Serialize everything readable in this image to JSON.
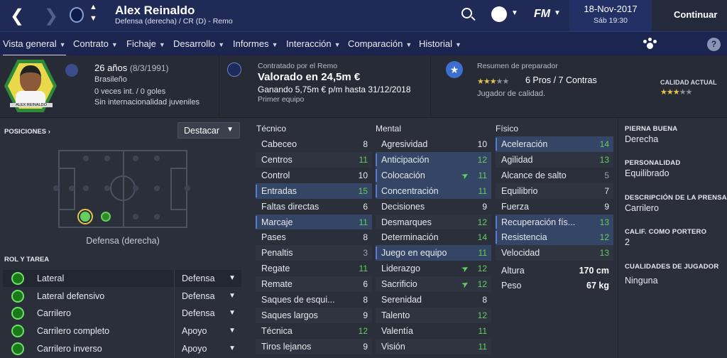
{
  "topbar": {
    "player_name": "Alex Reinaldo",
    "player_subtitle": "Defensa (derecha) / CR (D) - Remo",
    "date": "18-Nov-2017",
    "day_time": "Sáb 19:30",
    "continue_label": "Continuar",
    "fm_logo": "FM"
  },
  "nav": {
    "items": [
      {
        "label": "Vista general"
      },
      {
        "label": "Contrato"
      },
      {
        "label": "Fichaje"
      },
      {
        "label": "Desarrollo"
      },
      {
        "label": "Informes"
      },
      {
        "label": "Interacción"
      },
      {
        "label": "Comparación"
      },
      {
        "label": "Historial"
      }
    ]
  },
  "profile": {
    "photo_caption": "ALEX REINALDO",
    "age": "26 años",
    "birth": "(8/3/1991)",
    "nationality": "Brasileño",
    "caps": "0 veces int. / 0 goles",
    "youth": "Sin internacionalidad juveniles"
  },
  "contract": {
    "title": "Contratado por el Remo",
    "value": "Valorado en 24,5m €",
    "wage": "Ganando 5,75m € p/m hasta 31/12/2018",
    "squad": "Primer equipo"
  },
  "coach": {
    "title": "Resumen de preparador",
    "pros_cons": "6 Pros / 7 Contras",
    "verdict": "Jugador de calidad.",
    "stars": 2.5,
    "current_label": "CALIDAD ACTUAL",
    "current_stars": 2.5
  },
  "positions": {
    "title": "POSICIONES",
    "dropdown": "Destacar",
    "label": "Defensa (derecha)"
  },
  "roles": {
    "title": "ROL Y TAREA",
    "items": [
      {
        "name": "Lateral",
        "duty": "Defensa"
      },
      {
        "name": "Lateral defensivo",
        "duty": "Defensa"
      },
      {
        "name": "Carrilero",
        "duty": "Defensa"
      },
      {
        "name": "Carrilero completo",
        "duty": "Apoyo"
      },
      {
        "name": "Carrilero inverso",
        "duty": "Apoyo"
      }
    ]
  },
  "tecnico": {
    "title": "Técnico",
    "attrs": [
      {
        "name": "Cabeceo",
        "value": "8"
      },
      {
        "name": "Centros",
        "value": "11"
      },
      {
        "name": "Control",
        "value": "10"
      },
      {
        "name": "Entradas",
        "value": "15"
      },
      {
        "name": "Faltas directas",
        "value": "6"
      },
      {
        "name": "Marcaje",
        "value": "11"
      },
      {
        "name": "Pases",
        "value": "8"
      },
      {
        "name": "Penaltis",
        "value": "3"
      },
      {
        "name": "Regate",
        "value": "11"
      },
      {
        "name": "Remate",
        "value": "6"
      },
      {
        "name": "Saques de esqui...",
        "value": "8"
      },
      {
        "name": "Saques largos",
        "value": "9"
      },
      {
        "name": "Técnica",
        "value": "12"
      },
      {
        "name": "Tiros lejanos",
        "value": "9"
      }
    ]
  },
  "mental": {
    "title": "Mental",
    "attrs": [
      {
        "name": "Agresividad",
        "value": "10"
      },
      {
        "name": "Anticipación",
        "value": "12"
      },
      {
        "name": "Colocación",
        "value": "11"
      },
      {
        "name": "Concentración",
        "value": "11"
      },
      {
        "name": "Decisiones",
        "value": "9"
      },
      {
        "name": "Desmarques",
        "value": "12"
      },
      {
        "name": "Determinación",
        "value": "14"
      },
      {
        "name": "Juego en equipo",
        "value": "11"
      },
      {
        "name": "Liderazgo",
        "value": "12"
      },
      {
        "name": "Sacrificio",
        "value": "12"
      },
      {
        "name": "Serenidad",
        "value": "8"
      },
      {
        "name": "Talento",
        "value": "12"
      },
      {
        "name": "Valentía",
        "value": "11"
      },
      {
        "name": "Visión",
        "value": "11"
      }
    ]
  },
  "fisico": {
    "title": "Físico",
    "attrs": [
      {
        "name": "Aceleración",
        "value": "14"
      },
      {
        "name": "Agilidad",
        "value": "13"
      },
      {
        "name": "Alcance de salto",
        "value": "5"
      },
      {
        "name": "Equilibrio",
        "value": "7"
      },
      {
        "name": "Fuerza",
        "value": "9"
      },
      {
        "name": "Recuperación fís...",
        "value": "13"
      },
      {
        "name": "Resistencia",
        "value": "12"
      },
      {
        "name": "Velocidad",
        "value": "13"
      }
    ],
    "height_label": "Altura",
    "height": "170 cm",
    "weight_label": "Peso",
    "weight": "67 kg"
  },
  "side": {
    "foot_label": "PIERNA BUENA",
    "foot": "Derecha",
    "personality_label": "PERSONALIDAD",
    "personality": "Equilibrado",
    "press_label": "DESCRIPCIÓN DE LA PRENSA",
    "press": "Carrilero",
    "gk_label": "CALIF. COMO PORTERO",
    "gk": "2",
    "qualities_label": "CUALIDADES DE JUGADOR",
    "qualities": "Ninguna"
  },
  "colors": {
    "topbar": "#1f2a57",
    "background": "#2a2f3a",
    "accent_green": "#63d05b",
    "highlight": "#344566"
  }
}
